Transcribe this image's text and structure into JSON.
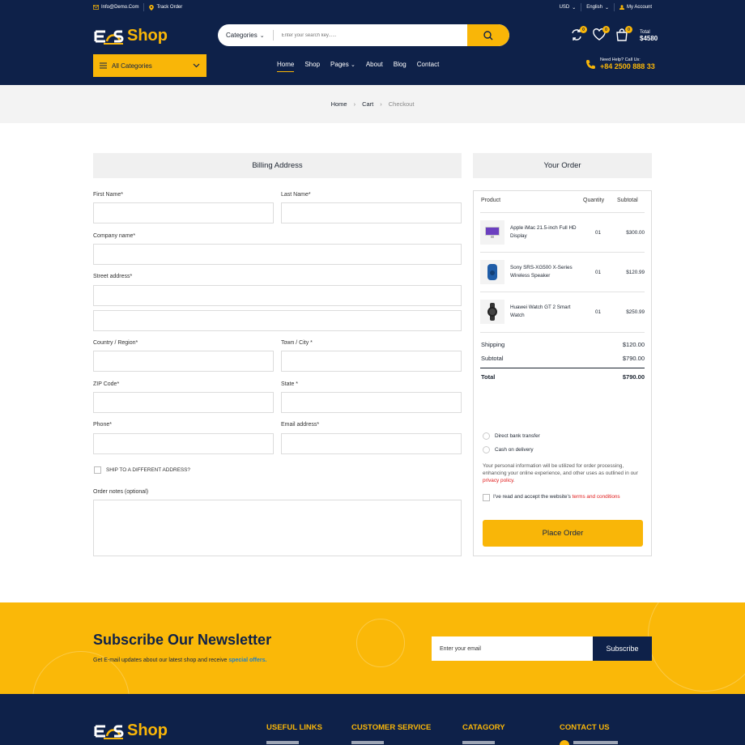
{
  "topbar": {
    "email": "Info@Demo.Com",
    "track": "Track Order",
    "currency": "USD",
    "language": "English",
    "account": "My Account"
  },
  "brand": {
    "prefix": "E",
    "name": "Shop",
    "accent": "#f9b608",
    "navy": "#0e2149"
  },
  "search": {
    "category_label": "Categories",
    "placeholder": "Enter your search key......"
  },
  "header_icons": {
    "compare_count": "0",
    "wishlist_count": "0",
    "cart_count": "0",
    "total_label": "Total",
    "total_value": "$4580"
  },
  "nav": {
    "all_categories": "All Categories",
    "items": [
      "Home",
      "Shop",
      "Pages",
      "About",
      "Blog",
      "Contact"
    ],
    "help_label": "Need Help? Call Us:",
    "help_phone": "+84 2500 888 33"
  },
  "breadcrumb": {
    "home": "Home",
    "cart": "Cart",
    "current": "Checkout"
  },
  "billing": {
    "title": "Billing Address",
    "first_name": "First Name*",
    "last_name": "Last Name*",
    "company": "Company name*",
    "street": "Street address*",
    "country": "Country / Region*",
    "town": "Town / City *",
    "zip": "ZIP Code*",
    "state": "State *",
    "phone": "Phone*",
    "email": "Email address*",
    "ship_different": "SHIP TO A DIFFERENT ADDRESS?",
    "notes": "Order notes (optional)"
  },
  "order": {
    "title": "Your Order",
    "col_product": "Product",
    "col_quantity": "Quantity",
    "col_subtotal": "Subtotal",
    "items": [
      {
        "name": "Apple iMac 21.5-inch Full HD Display",
        "qty": "01",
        "price": "$300.00",
        "icon": "imac-icon"
      },
      {
        "name": "Sony SRS-XG500 X-Series Wireless Speaker",
        "qty": "01",
        "price": "$120.99",
        "icon": "speaker-icon"
      },
      {
        "name": "Huawei Watch GT 2 Smart Watch",
        "qty": "01",
        "price": "$250.99",
        "icon": "watch-icon"
      }
    ],
    "shipping_label": "Shipping",
    "shipping_value": "$120.00",
    "subtotal_label": "Subtotal",
    "subtotal_value": "$790.00",
    "total_label": "Total",
    "total_value": "$790.00",
    "pay_bank": "Direct bank transfer",
    "pay_cod": "Cash on delivery",
    "privacy_text": "Your personal information will be utilized for order processing, enhancing your online experience, and other uses as outlined in our",
    "privacy_link": "privacy policy",
    "terms_text": "I've read and accept the website's",
    "terms_link": "terms and conditions",
    "place_order": "Place Order"
  },
  "newsletter": {
    "title": "Subscribe Our Newsletter",
    "subtitle": "Get E-mail updates about our latest shop and receive",
    "subtitle_link": "special offers.",
    "placeholder": "Enter your email",
    "button": "Subscribe"
  },
  "footer": {
    "col1": "USEFUL LINKS",
    "col2": "CUSTOMER SERVICE",
    "col3": "CATAGORY",
    "col4": "CONTACT US"
  }
}
